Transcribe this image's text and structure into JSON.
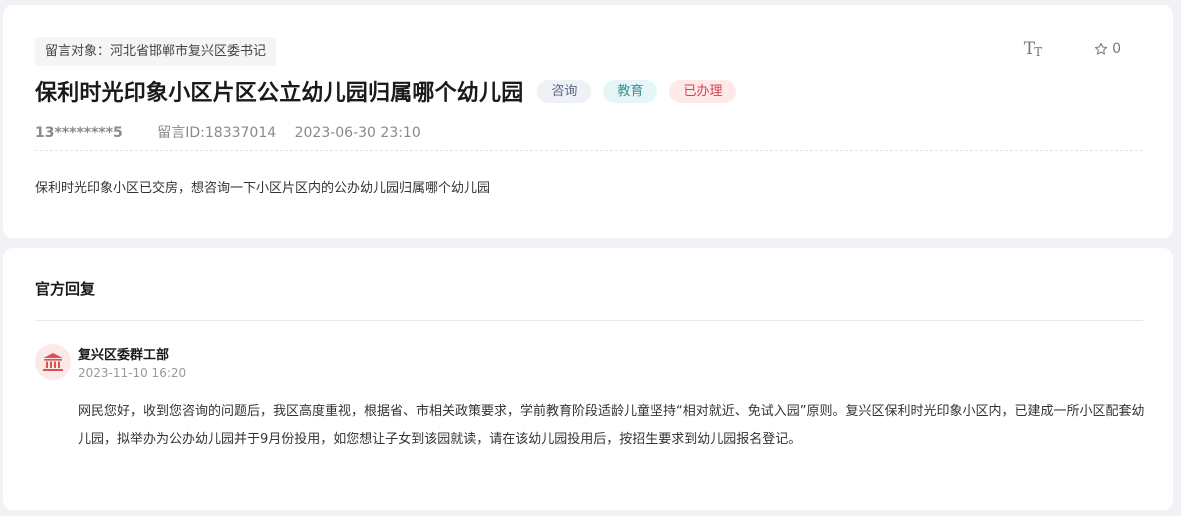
{
  "message": {
    "target_label": "留言对象：",
    "target_value": "河北省邯郸市复兴区委书记",
    "title": "保利时光印象小区片区公立幼儿园归属哪个幼儿园",
    "tags": [
      {
        "label": "咨询",
        "bg": "#eef1f6",
        "color": "#5a6a85"
      },
      {
        "label": "教育",
        "bg": "#e6f6f7",
        "color": "#3a8f96"
      },
      {
        "label": "已办理",
        "bg": "#fde8ea",
        "color": "#d8414f"
      }
    ],
    "user": "13********5",
    "id_text": "留言ID:18337014",
    "time": "2023-06-30 23:10",
    "content": "保利时光印象小区已交房，想咨询一下小区片区内的公办幼儿园归属哪个幼儿园"
  },
  "tools": {
    "font_icon": "font-size-icon",
    "font_big": "T",
    "font_small": "T",
    "favorite_icon": "star-icon",
    "favorite_count": "0"
  },
  "reply": {
    "heading": "官方回复",
    "avatar_icon": "government-building-icon",
    "department": "复兴区委群工部",
    "time": "2023-11-10 16:20",
    "text": "网民您好，收到您咨询的问题后，我区高度重视，根据省、市相关政策要求，学前教育阶段适龄儿童坚持“相对就近、免试入园”原则。复兴区保利时光印象小区内，已建成一所小区配套幼儿园，拟举办为公办幼儿园并于9月份投用，如您想让子女到该园就读，请在该幼儿园投用后，按招生要求到幼儿园报名登记。"
  },
  "colors": {
    "page_bg": "#f1f2f5",
    "card_bg": "#ffffff",
    "avatar_bg": "#fbe9e9",
    "avatar_icon": "#d9534f"
  }
}
